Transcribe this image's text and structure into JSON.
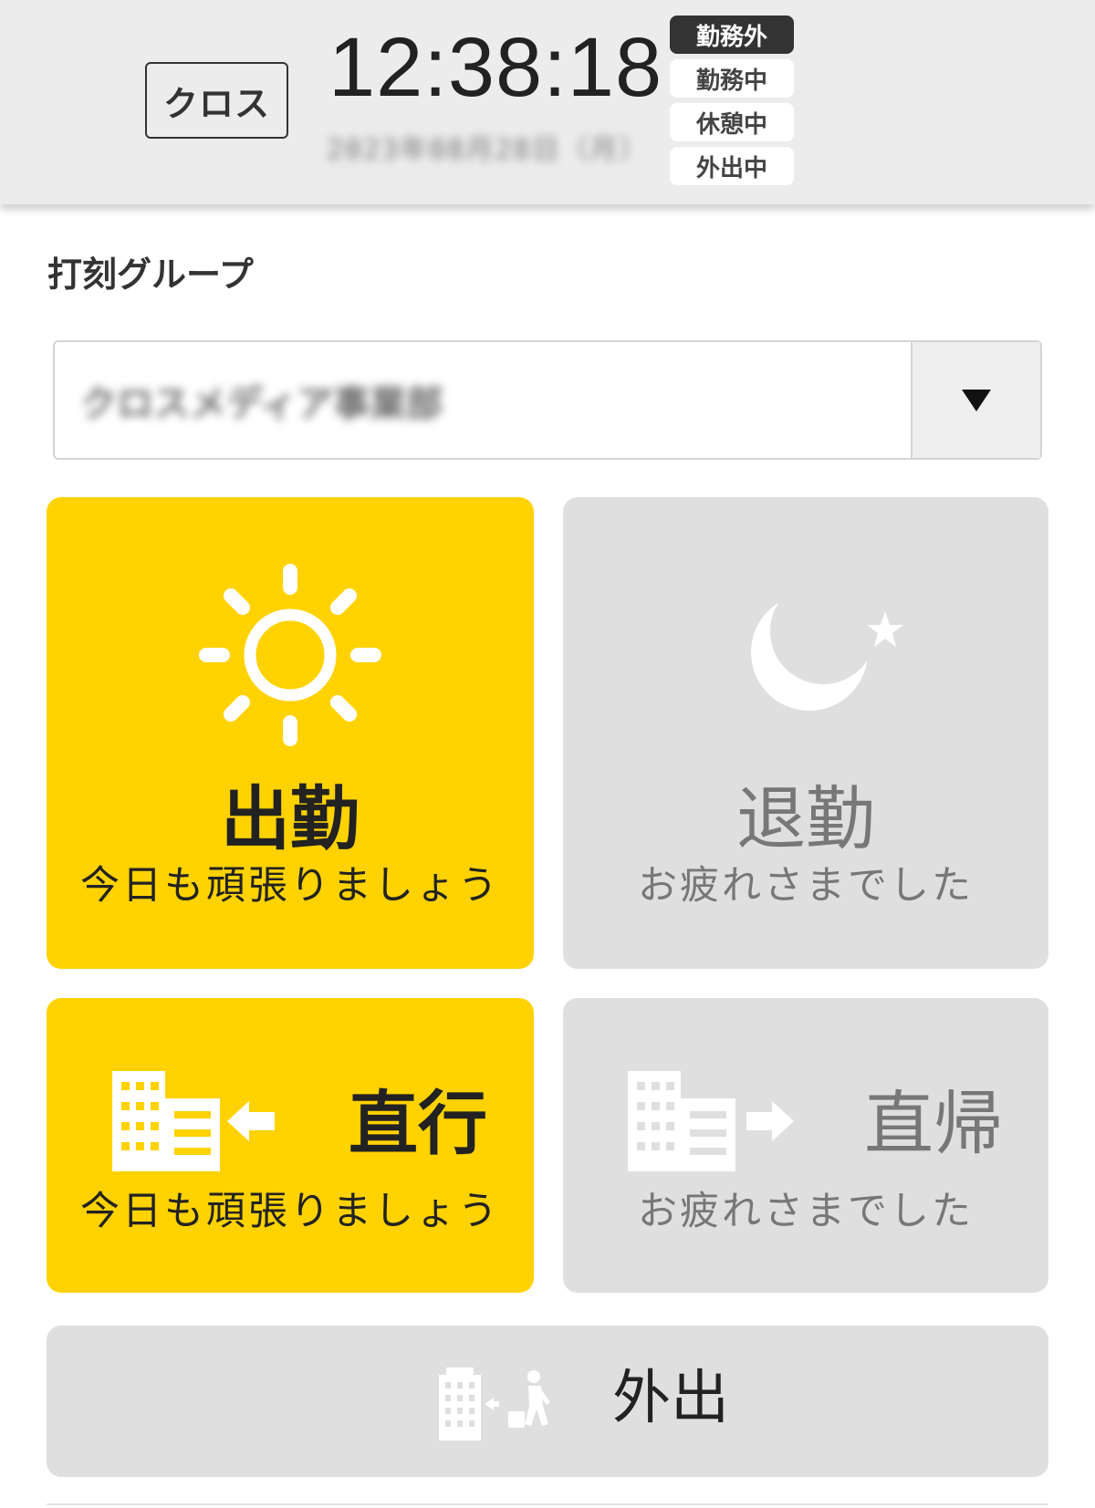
{
  "header": {
    "brand": "クロス",
    "clock": "12:38:18",
    "date_obscured": "2023年08月28日（月）",
    "statuses": [
      {
        "label": "勤務外",
        "active": true
      },
      {
        "label": "勤務中",
        "active": false
      },
      {
        "label": "休憩中",
        "active": false
      },
      {
        "label": "外出中",
        "active": false
      }
    ]
  },
  "group": {
    "label": "打刻グループ",
    "selected_obscured": "クロスメディア事業部",
    "dropdown_icon": "triangle-down-icon"
  },
  "punch": {
    "clock_in": {
      "title": "出勤",
      "subtitle": "今日も頑張りましょう",
      "icon": "sun-icon",
      "enabled": true
    },
    "clock_out": {
      "title": "退勤",
      "subtitle": "お疲れさまでした",
      "icon": "moon-star-icon",
      "enabled": false
    },
    "direct_go": {
      "title": "直行",
      "subtitle": "今日も頑張りましょう",
      "icon": "building-arrow-in-icon",
      "enabled": true
    },
    "direct_return": {
      "title": "直帰",
      "subtitle": "お疲れさまでした",
      "icon": "building-arrow-out-icon",
      "enabled": false
    },
    "go_out": {
      "title": "外出",
      "icon": "building-walker-icon"
    }
  },
  "colors": {
    "accent_yellow": "#ffd200",
    "disabled_gray": "#dfdfdf",
    "header_bg": "#ececec",
    "active_status": "#333333"
  }
}
